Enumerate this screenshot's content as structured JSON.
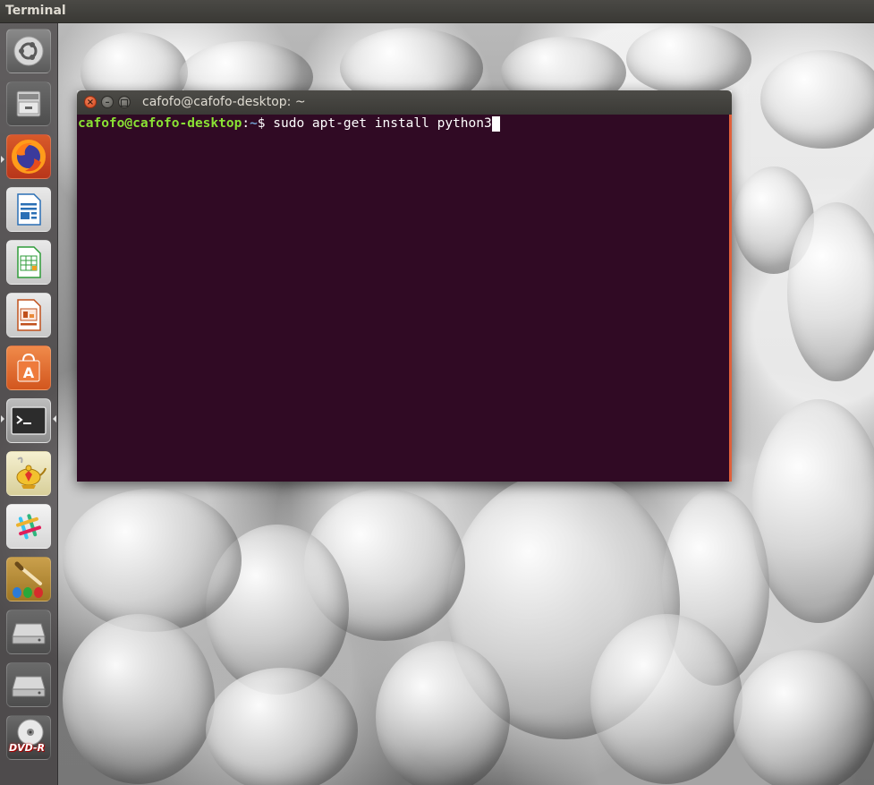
{
  "top_panel": {
    "app_name": "Terminal"
  },
  "launcher": {
    "items": [
      {
        "name": "ubuntu-dash",
        "icon": "ubuntu-logo-icon"
      },
      {
        "name": "files",
        "icon": "file-cabinet-icon"
      },
      {
        "name": "firefox",
        "icon": "firefox-icon"
      },
      {
        "name": "libreoffice-writer",
        "icon": "writer-document-icon"
      },
      {
        "name": "libreoffice-calc",
        "icon": "calc-spreadsheet-icon"
      },
      {
        "name": "libreoffice-impress",
        "icon": "impress-presentation-icon"
      },
      {
        "name": "ubuntu-software",
        "icon": "software-bag-icon"
      },
      {
        "name": "terminal",
        "icon": "terminal-icon",
        "active": true
      },
      {
        "name": "aladdin-lamp-app",
        "icon": "magic-lamp-icon"
      },
      {
        "name": "slack",
        "icon": "slack-icon"
      },
      {
        "name": "paint-app",
        "icon": "paint-brush-icon"
      },
      {
        "name": "drive-1",
        "icon": "hard-drive-icon"
      },
      {
        "name": "drive-2",
        "icon": "hard-drive-icon"
      },
      {
        "name": "dvd-r",
        "icon": "dvd-r-disc-icon",
        "label": "DVD-R"
      }
    ]
  },
  "terminal": {
    "title": "cafofo@cafofo-desktop: ~",
    "prompt_user_host": "cafofo@cafofo-desktop",
    "prompt_colon": ":",
    "prompt_path": "~",
    "prompt_symbol": "$ ",
    "command": "sudo apt-get install python3"
  },
  "colors": {
    "terminal_background": "#300a24",
    "prompt_user_color": "#8ae234",
    "prompt_path_color": "#729fcf",
    "close_button": "#e05a2b",
    "window_edge_accent": "#e0603a"
  }
}
